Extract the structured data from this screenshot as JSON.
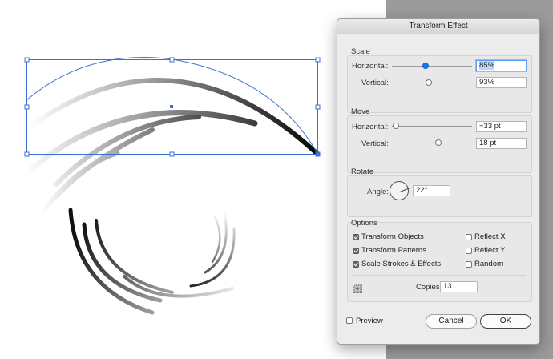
{
  "dialog": {
    "title": "Transform Effect",
    "scale": {
      "section_label": "Scale",
      "horizontal_label": "Horizontal:",
      "horizontal_value": "85%",
      "vertical_label": "Vertical:",
      "vertical_value": "93%"
    },
    "move": {
      "section_label": "Move",
      "horizontal_label": "Horizontal:",
      "horizontal_value": "−33 pt",
      "vertical_label": "Vertical:",
      "vertical_value": "18 pt"
    },
    "rotate": {
      "section_label": "Rotate",
      "angle_label": "Angle:",
      "angle_value": "22°"
    },
    "options": {
      "section_label": "Options",
      "transform_objects": {
        "label": "Transform Objects",
        "checked": true
      },
      "transform_patterns": {
        "label": "Transform Patterns",
        "checked": true
      },
      "scale_strokes": {
        "label": "Scale Strokes & Effects",
        "checked": true
      },
      "reflect_x": {
        "label": "Reflect X",
        "checked": false
      },
      "reflect_y": {
        "label": "Reflect Y",
        "checked": false
      },
      "random": {
        "label": "Random",
        "checked": false
      },
      "copies_label": "Copies",
      "copies_value": "13"
    },
    "preview": {
      "label": "Preview",
      "checked": false
    },
    "cancel_label": "Cancel",
    "ok_label": "OK"
  },
  "colors": {
    "selection": "#3b6fd1",
    "slider_active": "#1a73e8",
    "pasteboard": "#9b9b9b",
    "dialog_bg": "#ececec"
  }
}
